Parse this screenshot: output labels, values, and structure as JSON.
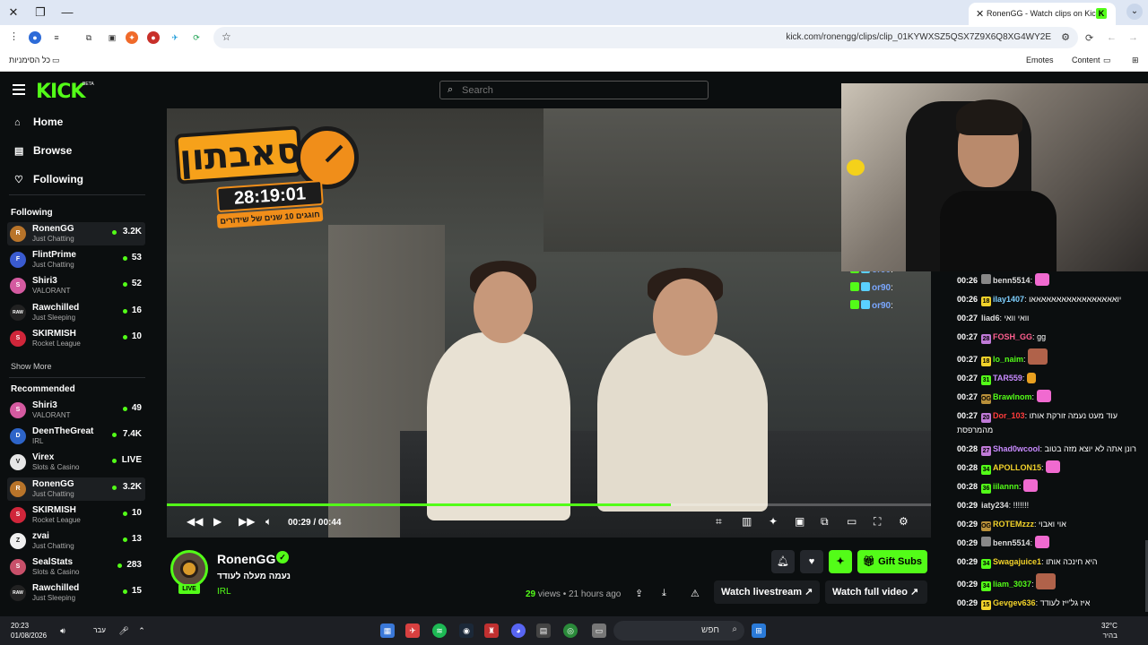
{
  "browser": {
    "tab_title": "RonenGG - Watch clips on Kick",
    "url": "kick.com/ronengg/clips/clip_01KYWXSZ5QSX7Z9X6Q8XG4WY2E",
    "bookmarks_all": "כל הסימניות",
    "bookmark_emotes": "Emotes",
    "bookmark_content": "Content"
  },
  "kick": {
    "logo": "KICK",
    "logo_badge": "BETA",
    "search_placeholder": "Search"
  },
  "sidebar": {
    "nav": [
      {
        "label": "Home",
        "icon": "home-icon"
      },
      {
        "label": "Browse",
        "icon": "browse-icon"
      },
      {
        "label": "Following",
        "icon": "heart-icon"
      }
    ],
    "following_title": "Following",
    "following": [
      {
        "name": "RonenGG",
        "category": "Just Chatting",
        "viewers": "3.2K",
        "color": "#b8742a",
        "initial": "R"
      },
      {
        "name": "FlintPrime",
        "category": "Just Chatting",
        "viewers": "53",
        "color": "#3a5bd0",
        "initial": "F"
      },
      {
        "name": "Shiri3",
        "category": "VALORANT",
        "viewers": "52",
        "color": "#d45aa0",
        "initial": "S"
      },
      {
        "name": "Rawchilled",
        "category": "Just Sleeping",
        "viewers": "16",
        "color": "#222222",
        "initial": "RAW"
      },
      {
        "name": "SKIRMISH",
        "category": "Rocket League",
        "viewers": "10",
        "color": "#d0263a",
        "initial": "S"
      }
    ],
    "show_more": "Show More",
    "recommended_title": "Recommended",
    "recommended": [
      {
        "name": "Shiri3",
        "category": "VALORANT",
        "viewers": "49",
        "color": "#d45aa0",
        "initial": "S"
      },
      {
        "name": "DeenTheGreat",
        "category": "IRL",
        "viewers": "7.4K",
        "color": "#2d64c8",
        "initial": "D"
      },
      {
        "name": "Virex",
        "category": "Slots & Casino",
        "viewers": "LIVE",
        "color": "#e6e6e6",
        "initial": "V"
      },
      {
        "name": "RonenGG",
        "category": "Just Chatting",
        "viewers": "3.2K",
        "color": "#b8742a",
        "initial": "R"
      },
      {
        "name": "SKIRMISH",
        "category": "Rocket League",
        "viewers": "10",
        "color": "#d0263a",
        "initial": "S"
      },
      {
        "name": "zvai",
        "category": "Just Chatting",
        "viewers": "13",
        "color": "#f0f0f0",
        "initial": "Z"
      },
      {
        "name": "SealStats",
        "category": "Slots & Casino",
        "viewers": "283",
        "color": "#c8506a",
        "initial": "S"
      },
      {
        "name": "Rawchilled",
        "category": "Just Sleeping",
        "viewers": "15",
        "color": "#222222",
        "initial": "RAW"
      }
    ]
  },
  "player": {
    "overlay_title": "סאבתון",
    "overlay_timer": "28:19:01",
    "overlay_sub": "חוגגים 10 שנים של שידורים",
    "time_current": "00:29",
    "time_sep": "/",
    "time_total": "00:44",
    "progress": 0.66
  },
  "clip": {
    "channel": "RonenGG",
    "title": "נעמה מעלה לעודד",
    "category": "IRL",
    "live_label": "LIVE",
    "views": "29",
    "views_label": "views",
    "age": "21 hours ago",
    "gift_subs": "Gift Subs",
    "watch_livestream": "Watch livestream",
    "watch_full_video": "Watch full video"
  },
  "chat_left": [
    {
      "user": "or90",
      "sep": ":"
    },
    {
      "user": "or90",
      "sep": ":"
    },
    {
      "user": "or90",
      "sep": ":"
    }
  ],
  "chat": [
    {
      "ts": "00:26",
      "badge": "",
      "badge_color": "#888888",
      "user": "benn5514",
      "user_color": "#dddddd",
      "text": "",
      "emote": "pink"
    },
    {
      "ts": "00:26",
      "badge": "18",
      "badge_color": "#f2d22a",
      "user": "ilay1407",
      "user_color": "#7ed0ff",
      "text": "יואאאאאאאאאאאאאאאאאו",
      "emote": ""
    },
    {
      "ts": "00:27",
      "badge": "",
      "badge_color": "",
      "user": "liad6",
      "user_color": "#dddddd",
      "text": "וואי וואי",
      "emote": ""
    },
    {
      "ts": "00:27",
      "badge": "28",
      "badge_color": "#c07ad8",
      "user": "FOSH_GG",
      "user_color": "#ff5f8f",
      "text": "gg",
      "emote": ""
    },
    {
      "ts": "00:27",
      "badge": "18",
      "badge_color": "#f2d22a",
      "user": "lo_naim",
      "user_color": "#53fc18",
      "text": "",
      "emote": "big"
    },
    {
      "ts": "00:27",
      "badge": "31",
      "badge_color": "#53fc18",
      "user": "TAR559",
      "user_color": "#c98bff",
      "text": "",
      "emote": "small"
    },
    {
      "ts": "00:27",
      "badge": "OG",
      "badge_color": "#b9903a",
      "user": "Brawlnom",
      "user_color": "#53fc18",
      "text": "",
      "emote": "pink"
    },
    {
      "ts": "00:27",
      "badge": "20",
      "badge_color": "#c07ad8",
      "user": "Dor_103",
      "user_color": "#ff3b3b",
      "text": "עוד מעט נעמה זורקת אותו מהמרפסת",
      "emote": ""
    },
    {
      "ts": "00:28",
      "badge": "27",
      "badge_color": "#c07ad8",
      "user": "Shad0wcool",
      "user_color": "#c98bff",
      "text": "רונן אתה לא יוצא מזה בטוב",
      "emote": ""
    },
    {
      "ts": "00:28",
      "badge": "34",
      "badge_color": "#53fc18",
      "user": "APOLLON15",
      "user_color": "#f2d22a",
      "text": "",
      "emote": "pink"
    },
    {
      "ts": "00:28",
      "badge": "36",
      "badge_color": "#53fc18",
      "user": "iilannn",
      "user_color": "#53fc18",
      "text": "",
      "emote": "pink"
    },
    {
      "ts": "00:29",
      "badge": "",
      "badge_color": "",
      "user": "iaty234",
      "user_color": "#dddddd",
      "text": "!!!!!!!",
      "emote": ""
    },
    {
      "ts": "00:29",
      "badge": "OG",
      "badge_color": "#b9903a",
      "user": "ROTEMzzz",
      "user_color": "#f2d22a",
      "text": "אוי ואבוי",
      "emote": ""
    },
    {
      "ts": "00:29",
      "badge": "",
      "badge_color": "#888888",
      "user": "benn5514",
      "user_color": "#dddddd",
      "text": "",
      "emote": "pink"
    },
    {
      "ts": "00:29",
      "badge": "34",
      "badge_color": "#53fc18",
      "user": "Swagajuice1",
      "user_color": "#f2d22a",
      "text": "היא חינכה אותו",
      "emote": ""
    },
    {
      "ts": "00:29",
      "badge": "34",
      "badge_color": "#53fc18",
      "user": "liam_3037",
      "user_color": "#53fc18",
      "text": "",
      "emote": "big"
    },
    {
      "ts": "00:29",
      "badge": "15",
      "badge_color": "#f2d22a",
      "user": "Gevgev636",
      "user_color": "#f2d22a",
      "text": "איז גל'ייז לעודד",
      "emote": ""
    }
  ],
  "taskbar": {
    "time": "20:23",
    "date": "01/08/2026",
    "lang": "עבר",
    "search_placeholder": "חפש",
    "temp": "32°C",
    "weather": "בהיר"
  },
  "colors": {
    "kick_green": "#53fc18",
    "background": "#0b0e0f"
  }
}
